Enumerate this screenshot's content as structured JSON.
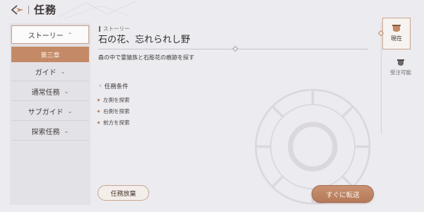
{
  "header": {
    "title": "任務",
    "back_icon": "back-arrow-icon"
  },
  "nav": {
    "items": [
      {
        "label": "ストーリー",
        "expanded": true,
        "active": true
      },
      {
        "label": "ガイド"
      },
      {
        "label": "通常任務"
      },
      {
        "label": "サブガイド"
      },
      {
        "label": "探索任務"
      }
    ],
    "sub_item": "第三章"
  },
  "quest": {
    "category": "ストーリー",
    "title": "石の花、忘れられし野",
    "description": "森の中で霊猿族と石彫花の痕跡を探す",
    "conditions_title": "任務条件",
    "conditions": [
      "左側を探索",
      "右側を探索",
      "前方を探索"
    ]
  },
  "buttons": {
    "abandon": "任務放棄",
    "teleport": "すぐに転送"
  },
  "tabs": {
    "current": "現在",
    "acceptable": "受注可能"
  },
  "colors": {
    "accent": "#c48a67",
    "background": "#ecebef",
    "nav_bg": "#e3e2e7"
  }
}
